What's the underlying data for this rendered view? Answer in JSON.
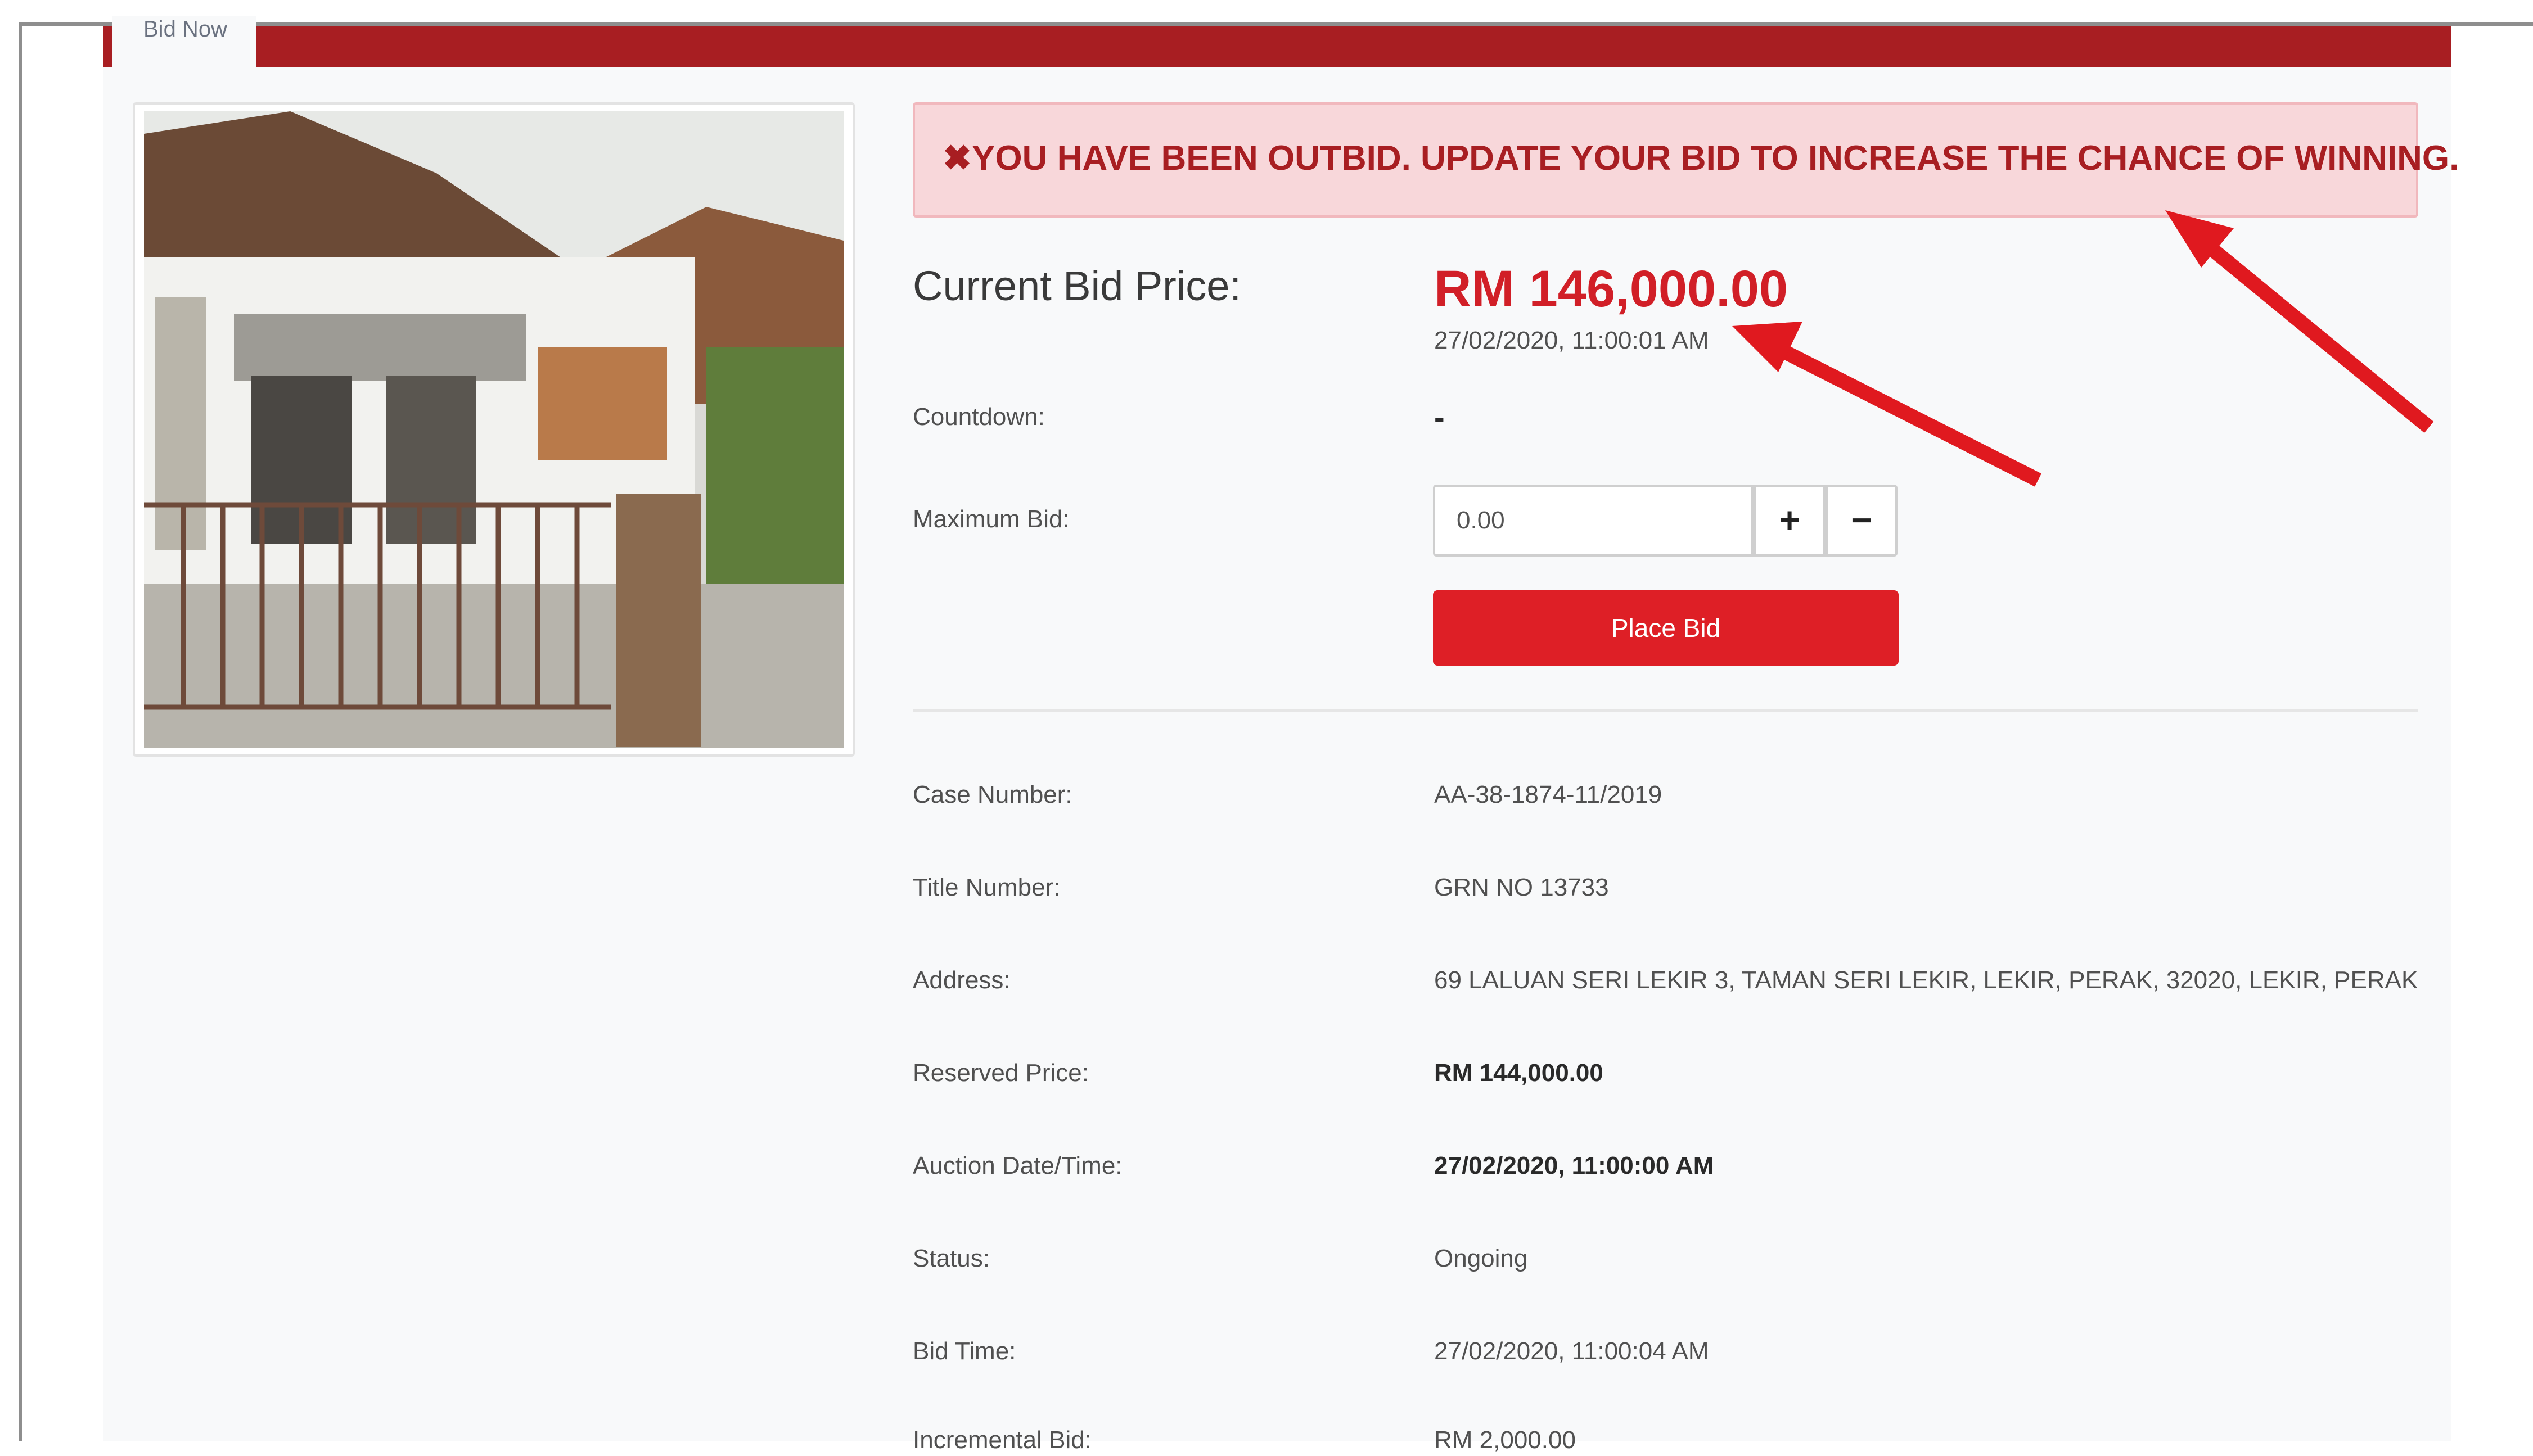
{
  "tab": {
    "label": "Bid Now"
  },
  "alert": {
    "icon": "close-icon",
    "message": "YOU HAVE BEEN OUTBID. UPDATE YOUR BID TO INCREASE THE CHANCE OF WINNING."
  },
  "bid": {
    "current_price_label": "Current Bid Price:",
    "current_price": "RM 146,000.00",
    "current_time": "27/02/2020, 11:00:01 AM",
    "countdown_label": "Countdown:",
    "countdown_value": "-",
    "maximum_bid_label": "Maximum Bid:",
    "maximum_bid_value": "0.00",
    "increase_symbol": "+",
    "decrease_symbol": "−",
    "place_bid_label": "Place Bid"
  },
  "details": [
    {
      "label": "Case Number:",
      "value": "AA-38-1874-11/2019"
    },
    {
      "label": "Title Number:",
      "value": "GRN NO 13733"
    },
    {
      "label": "Address:",
      "value": "69 LALUAN SERI LEKIR 3, TAMAN SERI LEKIR, LEKIR, PERAK, 32020, LEKIR, PERAK"
    },
    {
      "label": "Reserved Price:",
      "value": "RM 144,000.00"
    },
    {
      "label": "Auction Date/Time:",
      "value": "27/02/2020, 11:00:00 AM"
    },
    {
      "label": "Status:",
      "value": "Ongoing"
    },
    {
      "label": "Bid Time:",
      "value": "27/02/2020, 11:00:04 AM"
    },
    {
      "label": "Incremental Bid:",
      "value": "RM 2,000.00"
    }
  ],
  "colors": {
    "brand_red": "#a81e22",
    "price_red": "#d11f27",
    "button_red": "#de1f26",
    "annotation_arrow": "#e0191f"
  }
}
